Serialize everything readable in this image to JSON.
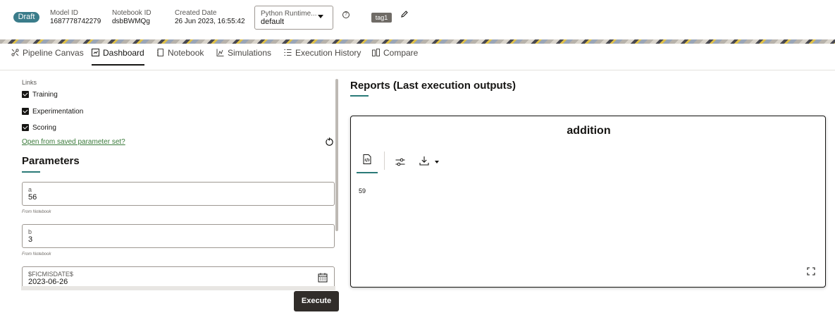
{
  "header": {
    "status_badge": "Draft",
    "model_id_label": "Model ID",
    "model_id_value": "1687778742279",
    "notebook_id_label": "Notebook ID",
    "notebook_id_value": "dsbBWMQg",
    "created_label": "Created Date",
    "created_value": "26 Jun 2023, 16:55:42",
    "runtime_label": "Python Runtime...",
    "runtime_value": "default",
    "help_glyph": "?",
    "tag": "tag1"
  },
  "tabs": [
    {
      "label": "Pipeline Canvas",
      "icon": "pipeline-icon"
    },
    {
      "label": "Dashboard",
      "icon": "dashboard-icon",
      "active": true
    },
    {
      "label": "Notebook",
      "icon": "notebook-icon"
    },
    {
      "label": "Simulations",
      "icon": "simulations-icon"
    },
    {
      "label": "Execution History",
      "icon": "list-icon"
    },
    {
      "label": "Compare",
      "icon": "compare-icon"
    }
  ],
  "links": {
    "label": "Links",
    "items": [
      {
        "label": "Training",
        "checked": true
      },
      {
        "label": "Experimentation",
        "checked": true
      },
      {
        "label": "Scoring",
        "checked": true
      }
    ],
    "saved_link": "Open from saved parameter set?"
  },
  "parameters": {
    "title": "Parameters",
    "fields": [
      {
        "label": "a",
        "value": "56",
        "hint": "From Notebook"
      },
      {
        "label": "b",
        "value": "3",
        "hint": "From Notebook"
      },
      {
        "label": "$FICMISDATE$",
        "value": "2023-06-26"
      }
    ],
    "execute_label": "Execute"
  },
  "reports": {
    "title": "Reports (Last execution outputs)",
    "card_title": "addition",
    "result": "59"
  },
  "colors": {
    "accent": "#2b7a78",
    "badge": "#3a7c8a",
    "button": "#312d2a",
    "link": "#3a7a3a"
  }
}
